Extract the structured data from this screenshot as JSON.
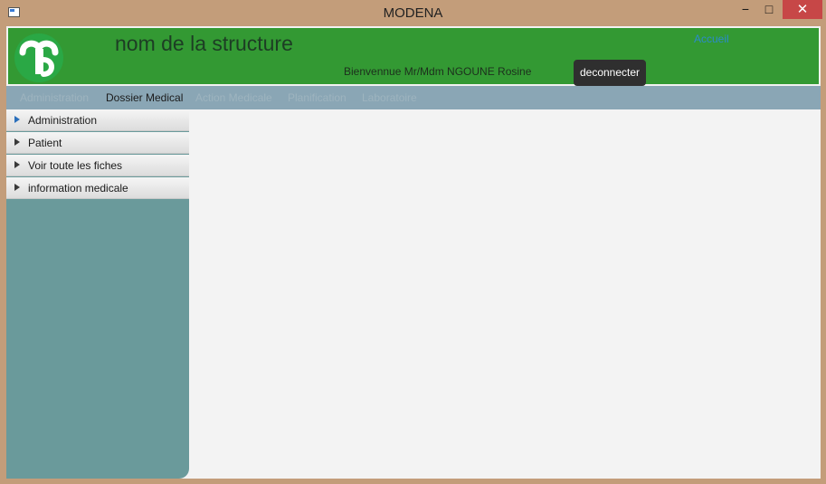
{
  "window": {
    "title": "MODENA",
    "minimize_label": "−",
    "maximize_label": "□",
    "close_label": "✕"
  },
  "header": {
    "structure_name": "nom de la structure",
    "welcome": "Bienvennue Mr/Mdm NGOUNE Rosine",
    "accueil_link": "Accueil",
    "logout_button": "deconnecter"
  },
  "menubar": {
    "items": [
      {
        "label": "Administration"
      },
      {
        "label": "Dossier Medical"
      },
      {
        "label": "Action Medicale"
      },
      {
        "label": "Planification"
      },
      {
        "label": "Laboratoire"
      }
    ],
    "active": "Dossier Medical"
  },
  "sidebar": {
    "items": [
      {
        "label": "Administration"
      },
      {
        "label": "Patient"
      },
      {
        "label": "Voir toute les fiches"
      },
      {
        "label": "information medicale"
      }
    ],
    "selected": "Administration"
  },
  "colors": {
    "header_green": "#339933",
    "menubar_blue_gray": "#8aa6b5",
    "sidebar_teal": "#6a9a9b",
    "logout_dark": "#2f2f2f",
    "accueil_link_blue": "#2c8acb"
  }
}
